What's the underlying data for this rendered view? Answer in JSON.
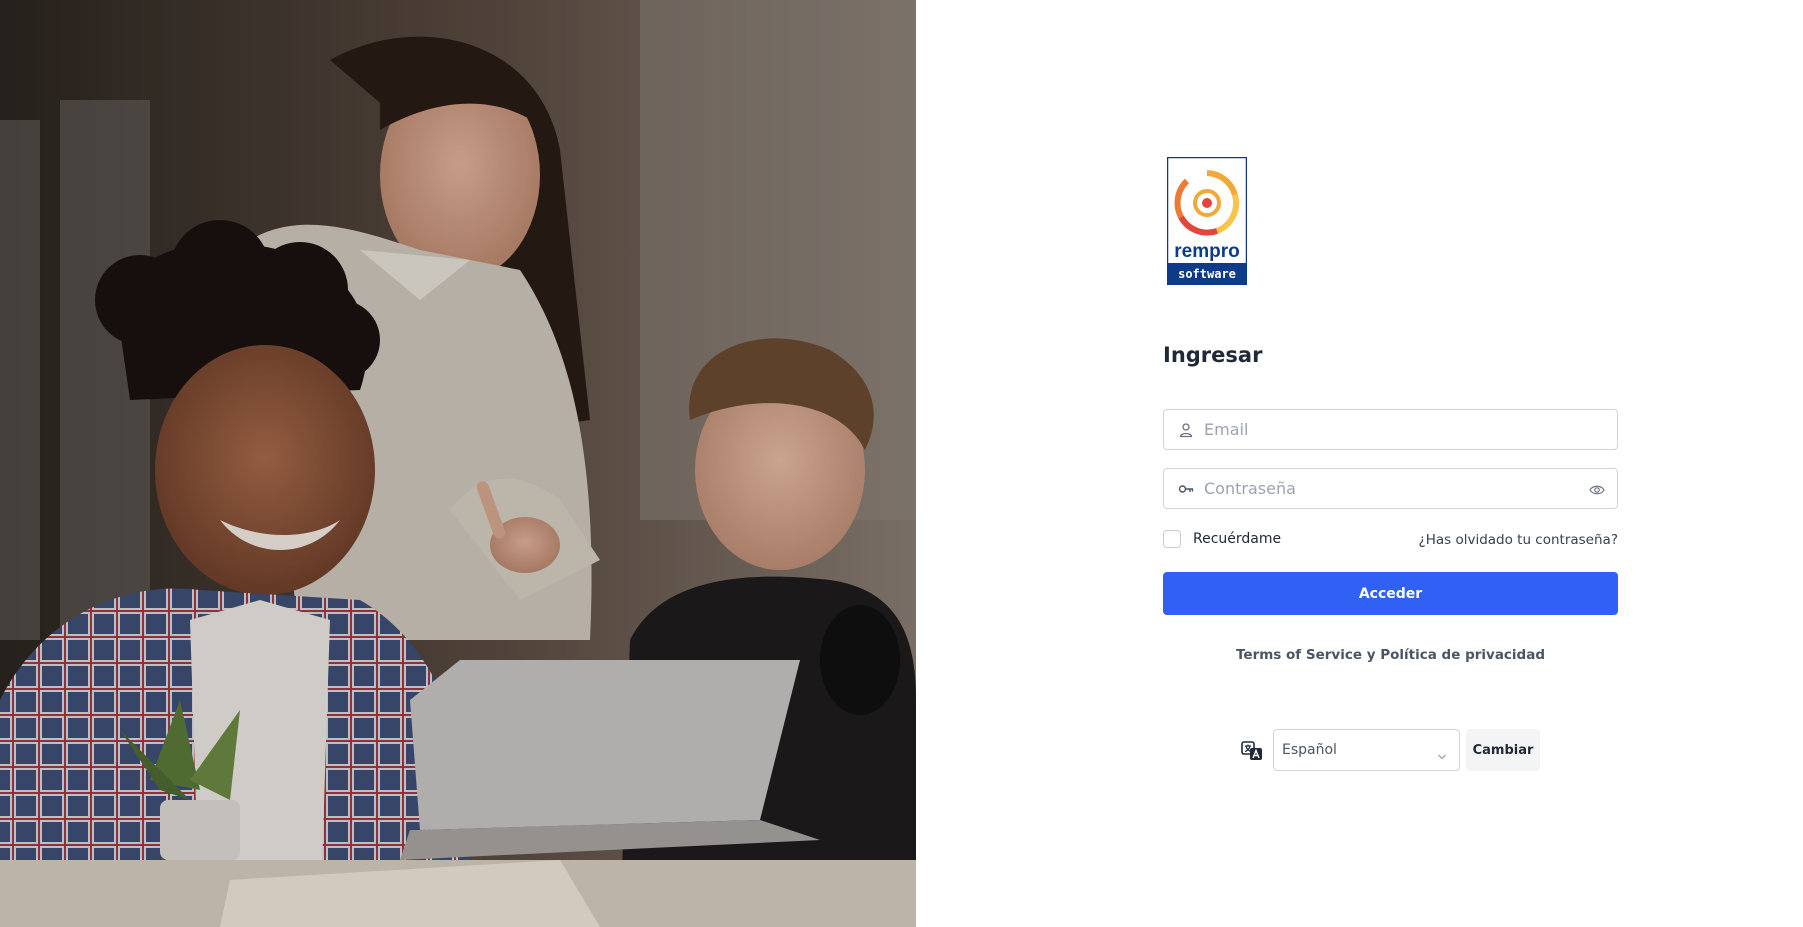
{
  "hero": {
    "image": "students-with-laptop-photo"
  },
  "brand": {
    "logo_name": "rempro",
    "logo_subtext": "software",
    "colors": {
      "logo_blue": "#0d3b8a",
      "logo_orange": "#f2a93b",
      "logo_red": "#e4453a"
    }
  },
  "login": {
    "title": "Ingresar",
    "email": {
      "placeholder": "Email",
      "value": "",
      "icon": "user-icon"
    },
    "password": {
      "placeholder": "Contraseña",
      "value": "",
      "icon": "key-icon",
      "toggle_icon": "eye-icon"
    },
    "remember_label": "Recuérdame",
    "remember_checked": false,
    "forgot_label": "¿Has olvidado tu contraseña?",
    "submit_label": "Acceder",
    "submit_color": "#3160f5"
  },
  "legal": {
    "terms": "Terms of Service",
    "conjunction": "y",
    "privacy": "Política de privacidad"
  },
  "language": {
    "icon": "translate-icon",
    "selected": "Español",
    "button_label": "Cambiar"
  }
}
